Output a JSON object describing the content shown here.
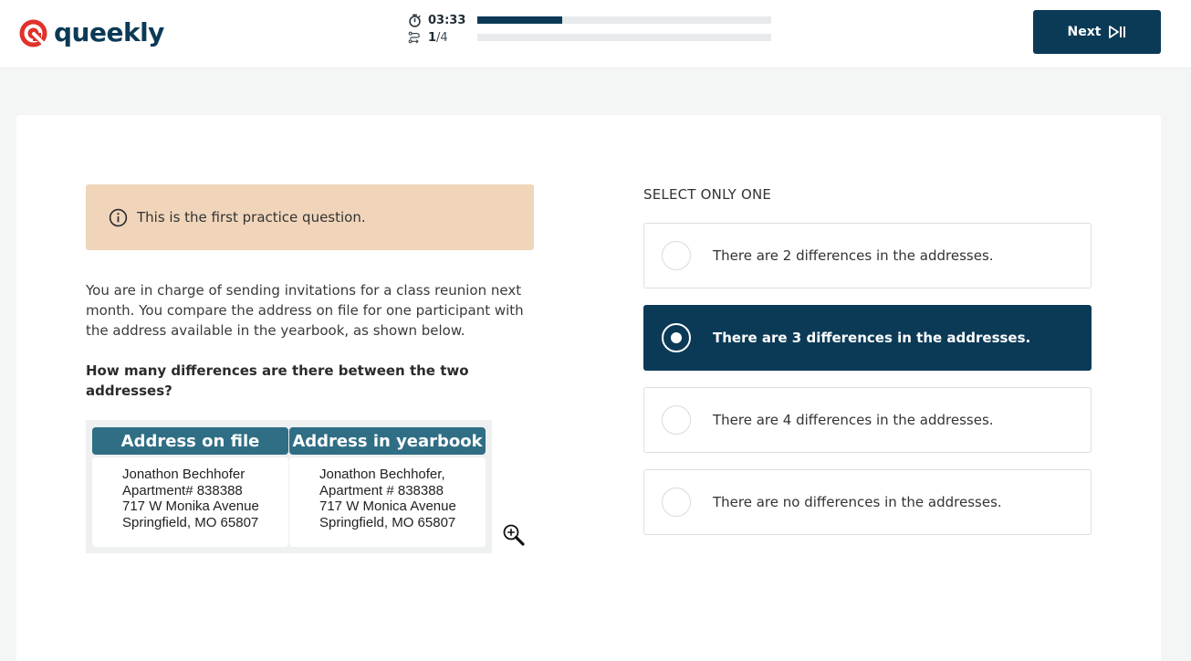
{
  "header": {
    "logo_text": "queekly",
    "timer": "03:33",
    "question_current": "1",
    "question_total": "/4",
    "timer_progress": 0.29,
    "question_progress": 0.0,
    "next_label": "Next"
  },
  "notice": {
    "icon": "info-icon",
    "text": "This is the first practice question."
  },
  "question": {
    "prompt": "You are in charge of sending invitations for a class reunion next month. You compare the address on file for one participant with the address available in the yearbook, as shown below.",
    "ask": "How many differences are there between the two addresses?"
  },
  "addresses": {
    "file": {
      "title": "Address on file",
      "lines": [
        "Jonathon Bechhofer",
        "Apartment# 838388",
        "717 W Monika Avenue",
        "Springfield, MO 65807"
      ]
    },
    "yearbook": {
      "title": "Address in yearbook",
      "lines": [
        "Jonathon Bechhofer,",
        "Apartment # 838388",
        "717 W Monica Avenue",
        "Springfield, MO 65807"
      ]
    },
    "zoom_icon": "zoom-in-icon"
  },
  "answers": {
    "instruction": "SELECT ONLY ONE",
    "options": [
      {
        "label": "There are 2 differences in the addresses.",
        "selected": false
      },
      {
        "label": "There are 3 differences in the addresses.",
        "selected": true
      },
      {
        "label": "There are 4 differences in the addresses.",
        "selected": false
      },
      {
        "label": "There are no differences in the addresses.",
        "selected": false
      }
    ]
  },
  "colors": {
    "brand_navy": "#0b3a57",
    "brand_red": "#e0322b",
    "notice_bg": "#f0d5ba",
    "table_header": "#2f6e85"
  }
}
